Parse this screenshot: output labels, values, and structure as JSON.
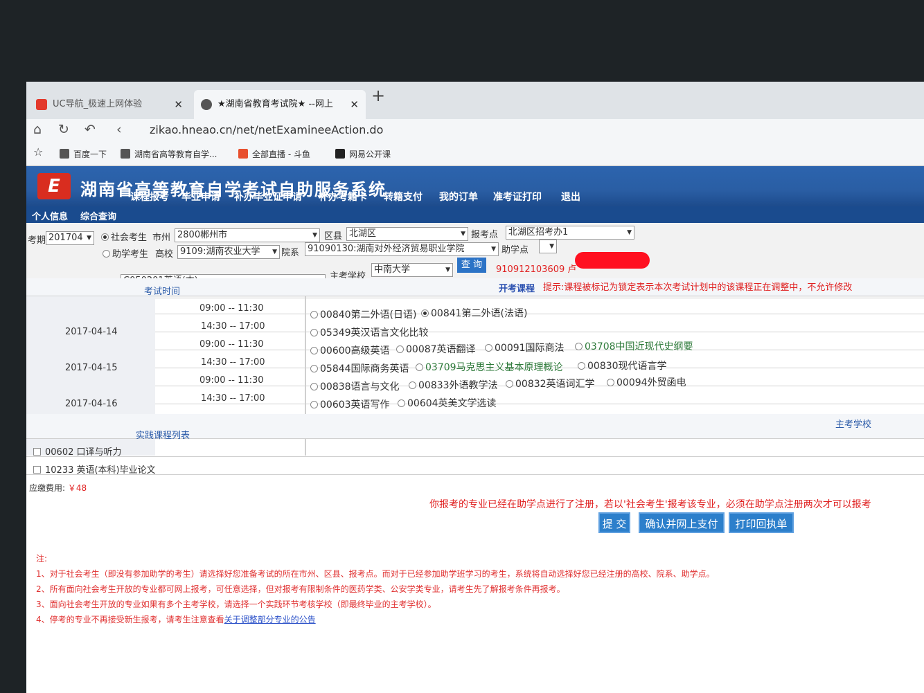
{
  "browser": {
    "tabs": [
      {
        "label": "UC导航_极速上网体验"
      },
      {
        "label": "★湖南省教育考试院★ --网上"
      }
    ],
    "new_tab": "+",
    "url": "zikao.hneao.cn/net/netExamineeAction.do",
    "bookmarks": [
      "百度一下",
      "湖南省高等教育自学...",
      "全部直播 - 斗鱼",
      "网易公开课"
    ]
  },
  "site": {
    "title": "湖南省高等教育自学考试自助服务系统",
    "logo_text": "E",
    "menu": [
      "课程报考",
      "毕业申请",
      "补办毕业证申请",
      "补办考籍卡",
      "转籍支付",
      "我的订单",
      "准考证打印",
      "退出"
    ],
    "submenu": [
      "个人信息",
      "综合查询"
    ]
  },
  "form": {
    "term_label": "考期",
    "term_value": "201704",
    "social_label": "社会考生",
    "city_label": "市州",
    "city_value": "2800郴州市",
    "district_label": "区县",
    "district_value": "北湖区",
    "site_label": "报考点",
    "site_value": "北湖区招考办1",
    "assist_label": "助学考生",
    "college_label": "高校",
    "college_value": "9109:湖南农业大学",
    "dept_label": "院系",
    "dept_value": "91090130:湖南对外经济贸易职业学院",
    "helppoint_label": "助学点",
    "major_label": "专业",
    "major_value": "C050201英语(本)",
    "main_school_label": "主考学校",
    "main_school_value": "中南大学",
    "query_button": "查 询",
    "student_id": "910912103609",
    "student_suffix": "卢"
  },
  "schedule": {
    "time_header": "考试时间",
    "course_header": "开考课程",
    "course_hint": "提示:课程被标记为锁定表示本次考试计划中的该课程正在调整中，不允许修改",
    "dates": [
      "2017-04-14",
      "2017-04-15",
      "2017-04-16"
    ],
    "slots": [
      {
        "time": "09:00 -- 11:30",
        "options": [
          {
            "text": "00840第二外语(日语)",
            "checked": false
          },
          {
            "text": "00841第二外语(法语)",
            "checked": true
          }
        ]
      },
      {
        "time": "14:30 -- 17:00",
        "options": [
          {
            "text": "05349英汉语言文化比较",
            "checked": false
          }
        ]
      },
      {
        "time": "09:00 -- 11:30",
        "options": [
          {
            "text": "00600高级英语",
            "checked": false
          },
          {
            "text": "00087英语翻译",
            "checked": false
          },
          {
            "text": "00091国际商法",
            "checked": false
          },
          {
            "text": "03708中国近现代史纲要",
            "checked": false,
            "green": true
          }
        ]
      },
      {
        "time": "14:30 -- 17:00",
        "options": [
          {
            "text": "05844国际商务英语",
            "checked": false
          },
          {
            "text": "03709马克思主义基本原理概论",
            "checked": false,
            "green": true
          },
          {
            "text": "00830现代语言学",
            "checked": false
          }
        ]
      },
      {
        "time": "09:00 -- 11:30",
        "options": [
          {
            "text": "00838语言与文化",
            "checked": false
          },
          {
            "text": "00833外语教学法",
            "checked": false
          },
          {
            "text": "00832英语词汇学",
            "checked": false
          },
          {
            "text": "00094外贸函电",
            "checked": false
          }
        ]
      },
      {
        "time": "14:30 -- 17:00",
        "options": [
          {
            "text": "00603英语写作",
            "checked": false
          },
          {
            "text": "00604英美文学选读",
            "checked": false
          }
        ]
      }
    ],
    "practice_header": "实践课程列表",
    "main_school_header": "主考学校",
    "practice": [
      "00602 口译与听力",
      "10233 英语(本科)毕业论文"
    ],
    "fee_label": "应缴费用:",
    "fee_value": "￥48"
  },
  "notice": "你报考的专业已经在助学点进行了注册，若以'社会考生'报考该专业，必须在助学点注册两次才可以报考",
  "buttons": {
    "submit": "提 交",
    "confirm_pay": "确认并网上支付",
    "print_receipt": "打印回执单"
  },
  "notes": {
    "title": "注:",
    "items": [
      "1、对于社会考生（即没有参加助学的考生）请选择好您准备考试的所在市州、区县、报考点。而对于已经参加助学班学习的考生，系统将自动选择好您已经注册的高校、院系、助学点。",
      "2、所有面向社会考生开放的专业都可网上报考，可任意选择，但对报考有限制条件的医药学类、公安学类专业，请考生先了解报考条件再报考。",
      "3、面向社会考生开放的专业如果有多个主考学校，请选择一个实践环节考核学校（即最终毕业的主考学校）。"
    ],
    "item4_prefix": "4、停考的专业不再接受新生报考，请考生注意查看",
    "item4_link": "关于调整部分专业的公告"
  },
  "colors": {
    "banner": "#2a5ea4",
    "red_text": "#e02020",
    "link": "#2a5aa8",
    "button": "#2c7fcb"
  }
}
